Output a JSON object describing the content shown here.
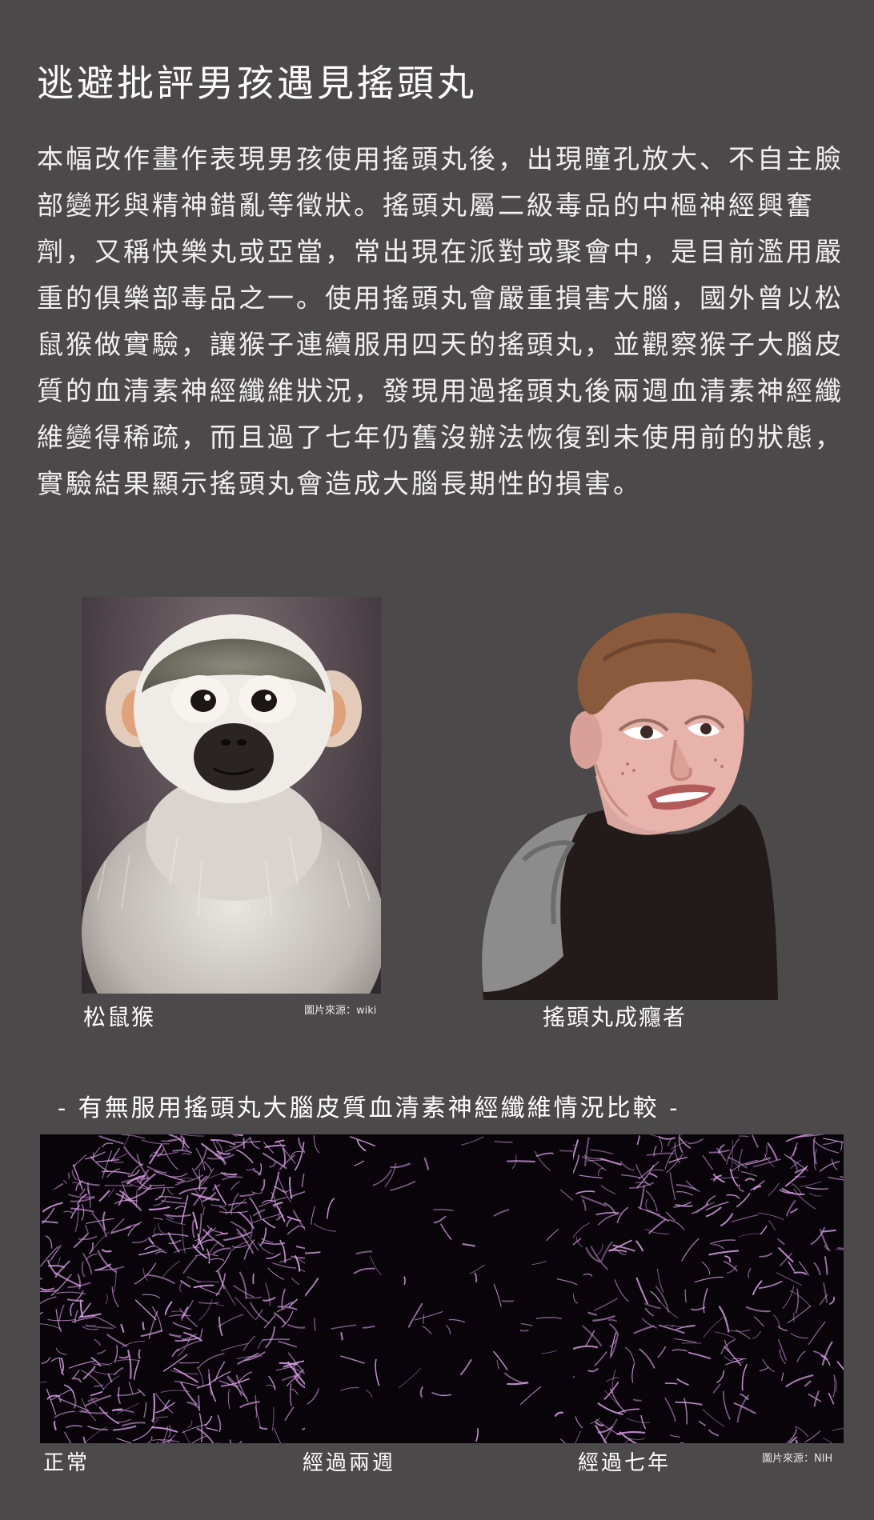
{
  "title": "逃避批評男孩遇見搖頭丸",
  "body": "本幅改作畫作表現男孩使用搖頭丸後，出現瞳孔放大、不自主臉部變形與精神錯亂等徵狀。搖頭丸屬二級毒品的中樞神經興奮劑，又稱快樂丸或亞當，常出現在派對或聚會中，是目前濫用嚴重的俱樂部毒品之一。使用搖頭丸會嚴重損害大腦，國外曾以松鼠猴做實驗，讓猴子連續服用四天的搖頭丸，並觀察猴子大腦皮質的血清素神經纖維狀況，發現用過搖頭丸後兩週血清素神經纖維變得稀疏，而且過了七年仍舊沒辦法恢復到未使用前的狀態，實驗結果顯示搖頭丸會造成大腦長期性的損害。",
  "monkey": {
    "caption": "松鼠猴",
    "source": "圖片來源：wiki"
  },
  "cartoon": {
    "caption": "搖頭丸成癮者"
  },
  "comparison": {
    "title": "- 有無服用搖頭丸大腦皮質血清素神經纖維情況比較 -",
    "panels": [
      {
        "label": "正常",
        "density": "dense"
      },
      {
        "label": "經過兩週",
        "density": "sparse"
      },
      {
        "label": "經過七年",
        "density": "medium"
      }
    ],
    "source": "圖片來源：NIH"
  },
  "colors": {
    "background": "#4b4949",
    "fiber": "#d59be0",
    "panel_bg": "#08040a"
  }
}
